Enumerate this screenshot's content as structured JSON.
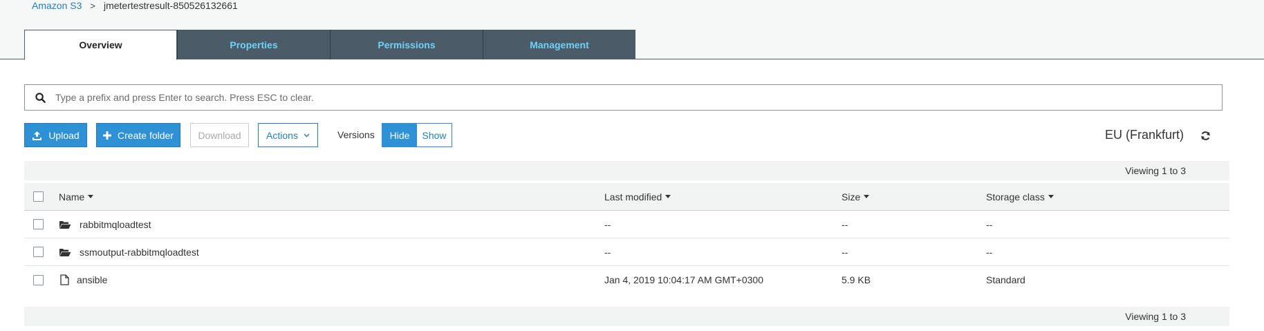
{
  "breadcrumb": {
    "root": "Amazon S3",
    "separator": ">",
    "bucket": "jmetertestresult-850526132661"
  },
  "tabs": [
    {
      "label": "Overview",
      "active": true
    },
    {
      "label": "Properties",
      "active": false
    },
    {
      "label": "Permissions",
      "active": false
    },
    {
      "label": "Management",
      "active": false
    }
  ],
  "search": {
    "placeholder": "Type a prefix and press Enter to search. Press ESC to clear.",
    "icon": "search-icon"
  },
  "toolbar": {
    "upload": "Upload",
    "create_folder": "Create folder",
    "download": "Download",
    "actions": "Actions",
    "versions_label": "Versions",
    "hide": "Hide",
    "show": "Show"
  },
  "region": "EU (Frankfurt)",
  "viewing_top": "Viewing 1 to 3",
  "viewing_bottom": "Viewing 1 to 3",
  "table": {
    "columns": [
      "Name",
      "Last modified",
      "Size",
      "Storage class"
    ],
    "rows": [
      {
        "type": "folder",
        "name": "rabbitmqloadtest",
        "last_modified": "--",
        "size": "--",
        "storage_class": "--"
      },
      {
        "type": "folder",
        "name": "ssmoutput-rabbitmqloadtest",
        "last_modified": "--",
        "size": "--",
        "storage_class": "--"
      },
      {
        "type": "file",
        "name": "ansible",
        "last_modified": "Jan 4, 2019 10:04:17 AM GMT+0300",
        "size": "5.9 KB",
        "storage_class": "Standard"
      }
    ]
  },
  "colors": {
    "accent": "#2e91d5",
    "link": "#1f7fc1",
    "tab_inactive_bg": "#4b5b68",
    "tab_inactive_text": "#6fd1f5"
  }
}
